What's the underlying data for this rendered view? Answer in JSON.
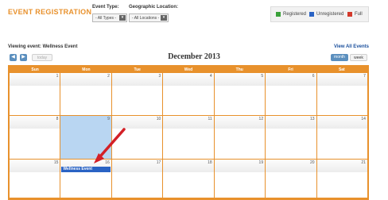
{
  "header": {
    "title": "EVENT REGISTRATION",
    "event_type_label": "Event Type:",
    "event_type_value": "- All Types -",
    "location_label": "Geographic Location:",
    "location_value": "- All Locations -"
  },
  "legend": [
    {
      "label": "Registered",
      "color": "#3aa13a"
    },
    {
      "label": "Unregistered",
      "color": "#2a63c4"
    },
    {
      "label": "Full",
      "color": "#d33a2c"
    }
  ],
  "toolbar": {
    "viewing": "Viewing event: Wellness Event",
    "view_all": "View All Events",
    "prev": "◀",
    "next": "▶",
    "today": "today",
    "month_title": "December 2013",
    "month_btn": "month",
    "week_btn": "week"
  },
  "calendar": {
    "days_of_week": [
      "Sun",
      "Mon",
      "Tue",
      "Wed",
      "Thu",
      "Fri",
      "Sat"
    ],
    "weeks": [
      [
        "1",
        "2",
        "3",
        "4",
        "5",
        "6",
        "7"
      ],
      [
        "8",
        "9",
        "10",
        "11",
        "12",
        "13",
        "14"
      ],
      [
        "15",
        "16",
        "17",
        "18",
        "19",
        "20",
        "21"
      ]
    ],
    "highlighted_day": "9",
    "event": {
      "day": "16",
      "label": "Wellness Event"
    }
  }
}
